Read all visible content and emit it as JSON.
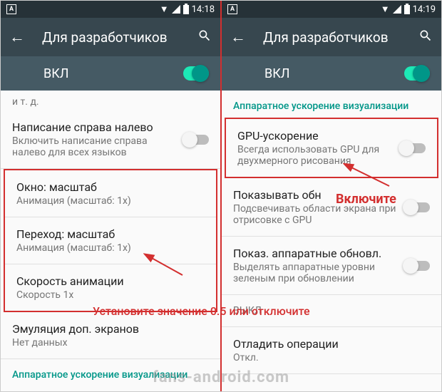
{
  "status": {
    "time_left": "14:18",
    "time_right": "14:19",
    "icon_letter": "A"
  },
  "header": {
    "title": "Для разработчиков"
  },
  "toggle": {
    "label": "ВКЛ"
  },
  "left": {
    "truncated": "и т. д.",
    "rtl": {
      "title": "Написание справа налево",
      "sub": "Включить написание справа налево для всех языков"
    },
    "window": {
      "title": "Окно: масштаб",
      "sub": "Анимация (масштаб: 1x)"
    },
    "transition": {
      "title": "Переход: масштаб",
      "sub": "Анимация (масштаб: 1x)"
    },
    "speed": {
      "title": "Скорость анимации",
      "sub": "Скорость 1x"
    },
    "emulation": {
      "title": "Эмуляция доп. экранов",
      "sub": "Нет данных"
    },
    "section": "Аппаратное ускорение визуализации"
  },
  "right": {
    "section": "Аппаратное ускорение визуализации",
    "gpu": {
      "title": "GPU-ускорение",
      "sub": "Всегда использовать GPU для двухмерного рисования"
    },
    "show_updates": {
      "title": "Показывать обн",
      "sub": "Подсвечивать области экрана при отрисовке с GPU"
    },
    "hw_updates": {
      "title": "Показ. аппаратные обновл.",
      "sub": "Выделять аппаратные уровни зеленым при обновлении"
    },
    "truncated1": {
      "title": "",
      "sub": "ВЫКЛ"
    },
    "truncated2": {
      "title": "Отладить операции",
      "sub": "Откл."
    }
  },
  "annotations": {
    "enable": "Включите",
    "set_value": "Установите значение 0.5 или отключите",
    "watermark": "fans-android.com"
  }
}
